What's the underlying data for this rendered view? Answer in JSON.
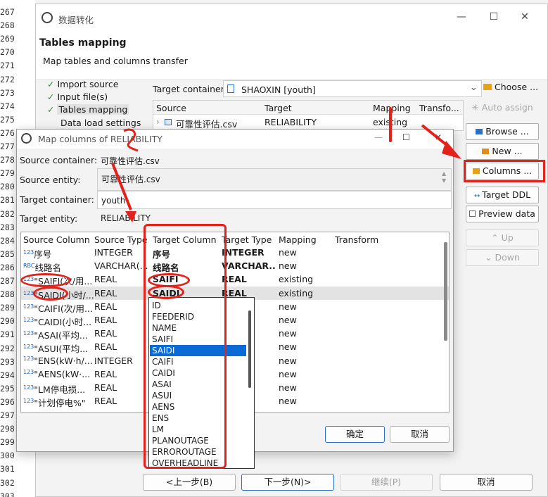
{
  "gutter": {
    "lines": [
      "267",
      "268",
      "269",
      "270",
      "271",
      "272",
      "273",
      "274",
      "275",
      "276",
      "277",
      "278",
      "279",
      "280",
      "281",
      "282",
      "283",
      "284",
      "285",
      "286",
      "287",
      "288",
      "289",
      "290",
      "291",
      "292",
      "293",
      "294",
      "295",
      "296",
      "297",
      "298",
      "299",
      "300",
      "301",
      "302",
      "303"
    ]
  },
  "wizard": {
    "title": "数据转化",
    "minimize": "—",
    "maximize": "☐",
    "close": "✕",
    "header_title": "Tables mapping",
    "header_subtitle": "Map tables and columns transfer",
    "steps": [
      "Import source",
      "Input file(s)",
      "Tables mapping",
      "Data load settings"
    ],
    "target_container_label": "Target container:",
    "target_container_value": "SHAOXIN  [youth]",
    "choose_button": "Choose ...",
    "table_headers": [
      "Source",
      "Target",
      "Mapping",
      "Transfo..."
    ],
    "table_row": {
      "source": "可靠性评估.csv",
      "target": "RELIABILITY",
      "mapping": "existing"
    },
    "side_buttons": [
      "Auto assign",
      "Browse ...",
      "New ...",
      "Columns ...",
      "Target DDL",
      "Preview data",
      "Up",
      "Down"
    ],
    "bottom_buttons": [
      "<上一步(B)",
      "下一步(N)>",
      "继续(P)",
      "取消"
    ]
  },
  "dialog": {
    "title": "Map columns of RELIABILITY",
    "fields": [
      {
        "label": "Source container:",
        "value": "可靠性评估.csv"
      },
      {
        "label": "Source entity:",
        "value": "可靠性评估.csv"
      },
      {
        "label": "Target container:",
        "value": "youth"
      },
      {
        "label": "Target entity:",
        "value": "RELIABILITY"
      }
    ],
    "columns_header": [
      "Source Column",
      "Source Type",
      "Target Column",
      "Target Type",
      "Mapping",
      "Transform"
    ],
    "rows": [
      {
        "src": "序号",
        "src_type": "INTEGER",
        "tgt": "序号",
        "tgt_type": "INTEGER",
        "map": "new",
        "icon": "123"
      },
      {
        "src": "线路名",
        "src_type": "VARCHAR(...",
        "tgt": "线路名",
        "tgt_type": "VARCHAR...",
        "map": "new",
        "icon": "RBC"
      },
      {
        "src": "\"SAIFI(次/用...",
        "src_type": "REAL",
        "tgt": "SAIFI",
        "tgt_type": "REAL",
        "map": "existing",
        "icon": "123"
      },
      {
        "src": "\"SAIDI(小时/...",
        "src_type": "REAL",
        "tgt": "SAIDI",
        "tgt_type": "REAL",
        "map": "existing",
        "icon": "123"
      },
      {
        "src": "\"CAIFI(次/用...",
        "src_type": "REAL",
        "tgt": "",
        "tgt_type": "",
        "map": "new",
        "icon": "123"
      },
      {
        "src": "\"CAIDI(小时...",
        "src_type": "REAL",
        "tgt": "",
        "tgt_type": "",
        "map": "new",
        "icon": "123"
      },
      {
        "src": "\"ASAI(平均...",
        "src_type": "REAL",
        "tgt": "",
        "tgt_type": "",
        "map": "new",
        "icon": "123"
      },
      {
        "src": "\"ASUI(平均...",
        "src_type": "REAL",
        "tgt": "",
        "tgt_type": "",
        "map": "new",
        "icon": "123"
      },
      {
        "src": "\"ENS(kW·h/...",
        "src_type": "INTEGER",
        "tgt": "",
        "tgt_type": "R",
        "map": "new",
        "icon": "123"
      },
      {
        "src": "\"AENS(kW·...",
        "src_type": "REAL",
        "tgt": "",
        "tgt_type": "",
        "map": "new",
        "icon": "123"
      },
      {
        "src": "\"LM停电损...",
        "src_type": "REAL",
        "tgt": "",
        "tgt_type": "",
        "map": "new",
        "icon": "123"
      },
      {
        "src": "\"计划停电%\"",
        "src_type": "REAL",
        "tgt": "",
        "tgt_type": "",
        "map": "new",
        "icon": "123"
      }
    ],
    "dropdown_items": [
      "ID",
      "FEEDERID",
      "NAME",
      "SAIFI",
      "SAIDI",
      "CAIFI",
      "CAIDI",
      "ASAI",
      "ASUI",
      "AENS",
      "ENS",
      "LM",
      "PLANOUTAGE",
      "ERROROUTAGE",
      "OVERHEADLINE"
    ],
    "dropdown_selected": "SAIDI",
    "ok_button": "确定",
    "cancel_button": "取消"
  },
  "colors": {
    "annotation_red": "#e3221c",
    "selection_blue": "#0b6bd6",
    "check_green": "#2e8b3a"
  }
}
